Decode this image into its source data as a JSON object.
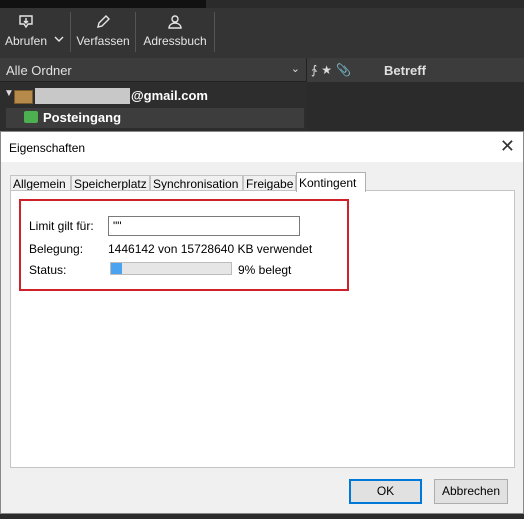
{
  "toolbar": {
    "abrufen": "Abrufen",
    "verfassen": "Verfassen",
    "adressbuch": "Adressbuch"
  },
  "folder_header": {
    "label": "Alle Ordner"
  },
  "thread_header": {
    "betreff": "Betreff"
  },
  "account": {
    "email_suffix": "@gmail.com"
  },
  "inbox": {
    "label": "Posteingang"
  },
  "dialog": {
    "title": "Eigenschaften",
    "tabs": [
      {
        "label": "Allgemein",
        "active": false
      },
      {
        "label": "Speicherplatz",
        "active": false
      },
      {
        "label": "Synchronisation",
        "active": false
      },
      {
        "label": "Freigabe",
        "active": false
      },
      {
        "label": "Kontingent",
        "active": true
      }
    ],
    "kontingent": {
      "limit_label": "Limit gilt für:",
      "limit_value": "\"\"",
      "belegung_label": "Belegung:",
      "belegung_value": "1446142 von 15728640 KB verwendet",
      "status_label": "Status:",
      "status_percent": 9,
      "status_text": "9% belegt"
    },
    "ok_label": "OK",
    "cancel_label": "Abbrechen"
  },
  "colors": {
    "highlight": "#d0202a",
    "progress_fill": "#4aa3f0",
    "primary_border": "#0078d7"
  }
}
